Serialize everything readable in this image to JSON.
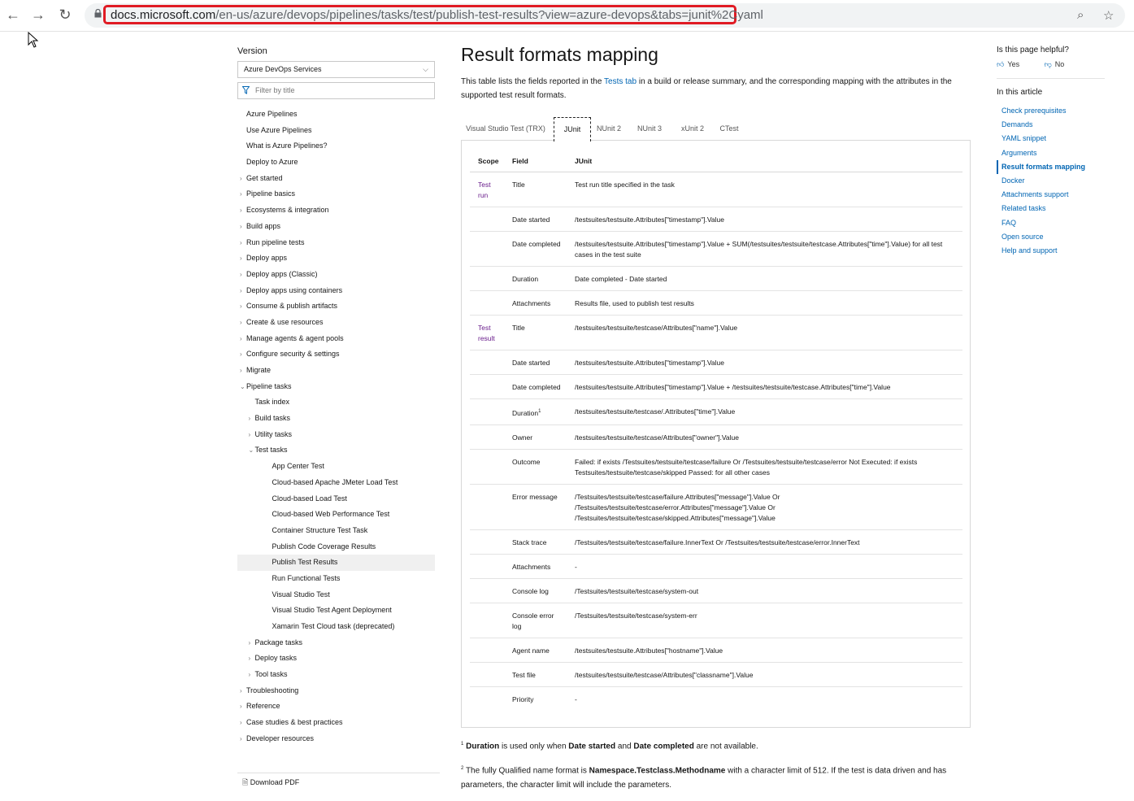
{
  "browser": {
    "url_domain": "docs.microsoft.com",
    "url_path": "/en-us/azure/devops/pipelines/tasks/test/publish-test-results?view=azure-devops&tabs=junit%2Cyaml"
  },
  "sidebar": {
    "version_label": "Version",
    "version_selected": "Azure DevOps Services",
    "filter_placeholder": "Filter by title",
    "items": [
      {
        "label": "Azure Pipelines",
        "level": 0,
        "twisty": ""
      },
      {
        "label": "Use Azure Pipelines",
        "level": 0,
        "twisty": ""
      },
      {
        "label": "What is Azure Pipelines?",
        "level": 0,
        "twisty": ""
      },
      {
        "label": "Deploy to Azure",
        "level": 0,
        "twisty": ""
      },
      {
        "label": "Get started",
        "level": 0,
        "twisty": "›"
      },
      {
        "label": "Pipeline basics",
        "level": 0,
        "twisty": "›"
      },
      {
        "label": "Ecosystems & integration",
        "level": 0,
        "twisty": "›"
      },
      {
        "label": "Build apps",
        "level": 0,
        "twisty": "›"
      },
      {
        "label": "Run pipeline tests",
        "level": 0,
        "twisty": "›"
      },
      {
        "label": "Deploy apps",
        "level": 0,
        "twisty": "›"
      },
      {
        "label": "Deploy apps (Classic)",
        "level": 0,
        "twisty": "›"
      },
      {
        "label": "Deploy apps using containers",
        "level": 0,
        "twisty": "›"
      },
      {
        "label": "Consume & publish artifacts",
        "level": 0,
        "twisty": "›"
      },
      {
        "label": "Create & use resources",
        "level": 0,
        "twisty": "›"
      },
      {
        "label": "Manage agents & agent pools",
        "level": 0,
        "twisty": "›"
      },
      {
        "label": "Configure security & settings",
        "level": 0,
        "twisty": "›"
      },
      {
        "label": "Migrate",
        "level": 0,
        "twisty": "›"
      },
      {
        "label": "Pipeline tasks",
        "level": 0,
        "twisty": "⌄"
      },
      {
        "label": "Task index",
        "level": 1,
        "twisty": ""
      },
      {
        "label": "Build tasks",
        "level": 1,
        "twisty": "›"
      },
      {
        "label": "Utility tasks",
        "level": 1,
        "twisty": "›"
      },
      {
        "label": "Test tasks",
        "level": 1,
        "twisty": "⌄"
      },
      {
        "label": "App Center Test",
        "level": 2,
        "twisty": ""
      },
      {
        "label": "Cloud-based Apache JMeter Load Test",
        "level": 2,
        "twisty": ""
      },
      {
        "label": "Cloud-based Load Test",
        "level": 2,
        "twisty": ""
      },
      {
        "label": "Cloud-based Web Performance Test",
        "level": 2,
        "twisty": ""
      },
      {
        "label": "Container Structure Test Task",
        "level": 2,
        "twisty": ""
      },
      {
        "label": "Publish Code Coverage Results",
        "level": 2,
        "twisty": ""
      },
      {
        "label": "Publish Test Results",
        "level": 2,
        "twisty": "",
        "selected": true
      },
      {
        "label": "Run Functional Tests",
        "level": 2,
        "twisty": ""
      },
      {
        "label": "Visual Studio Test",
        "level": 2,
        "twisty": ""
      },
      {
        "label": "Visual Studio Test Agent Deployment",
        "level": 2,
        "twisty": ""
      },
      {
        "label": "Xamarin Test Cloud task (deprecated)",
        "level": 2,
        "twisty": ""
      },
      {
        "label": "Package tasks",
        "level": 1,
        "twisty": "›"
      },
      {
        "label": "Deploy tasks",
        "level": 1,
        "twisty": "›"
      },
      {
        "label": "Tool tasks",
        "level": 1,
        "twisty": "›"
      },
      {
        "label": "Troubleshooting",
        "level": 0,
        "twisty": "›"
      },
      {
        "label": "Reference",
        "level": 0,
        "twisty": "›"
      },
      {
        "label": "Case studies & best practices",
        "level": 0,
        "twisty": "›"
      },
      {
        "label": "Developer resources",
        "level": 0,
        "twisty": "›"
      }
    ],
    "download_pdf": "Download PDF"
  },
  "main": {
    "title": "Result formats mapping",
    "intro_before": "This table lists the fields reported in the ",
    "intro_link": "Tests tab",
    "intro_after": " in a build or release summary, and the corresponding mapping with the attributes in the supported test result formats.",
    "tabs": [
      {
        "label": "Visual Studio Test (TRX)",
        "active": false
      },
      {
        "label": "JUnit",
        "active": true
      },
      {
        "label": "NUnit 2",
        "active": false
      },
      {
        "label": "NUnit 3",
        "active": false
      },
      {
        "label": "xUnit 2",
        "active": false
      },
      {
        "label": "CTest",
        "active": false
      }
    ],
    "table_headers": [
      "Scope",
      "Field",
      "JUnit"
    ],
    "rows": [
      {
        "scope": "Test run",
        "field": "Title",
        "value": "Test run title specified in the task"
      },
      {
        "scope": "",
        "field": "Date started",
        "value": "/testsuites/testsuite.Attributes[\"timestamp\"].Value"
      },
      {
        "scope": "",
        "field": "Date completed",
        "value": "/testsuites/testsuite.Attributes[\"timestamp\"].Value + SUM(/testsuites/testsuite/testcase.Attributes[\"time\"].Value) for all test cases in the test suite"
      },
      {
        "scope": "",
        "field": "Duration",
        "value": "Date completed - Date started"
      },
      {
        "scope": "",
        "field": "Attachments",
        "value": "Results file, used to publish test results"
      },
      {
        "scope": "Test result",
        "field": "Title",
        "value": "/testsuites/testsuite/testcase/Attributes[\"name\"].Value"
      },
      {
        "scope": "",
        "field": "Date started",
        "value": "/testsuites/testsuite.Attributes[\"timestamp\"].Value"
      },
      {
        "scope": "",
        "field": "Date completed",
        "value": "/testsuites/testsuite.Attributes[\"timestamp\"].Value + /testsuites/testsuite/testcase.Attributes[\"time\"].Value"
      },
      {
        "scope": "",
        "field": "Duration",
        "sup": "1",
        "value": "/testsuites/testsuite/testcase/.Attributes[\"time\"].Value"
      },
      {
        "scope": "",
        "field": "Owner",
        "value": "/testsuites/testsuite/testcase/Attributes[\"owner\"].Value"
      },
      {
        "scope": "",
        "field": "Outcome",
        "value": "Failed: if exists /Testsuites/testsuite/testcase/failure Or /Testsuites/testsuite/testcase/error Not Executed: if exists Testsuites/testsuite/testcase/skipped Passed: for all other cases"
      },
      {
        "scope": "",
        "field": "Error message",
        "value": "/Testsuites/testsuite/testcase/failure.Attributes[\"message\"].Value Or /Testsuites/testsuite/testcase/error.Attributes[\"message\"].Value Or /Testsuites/testsuite/testcase/skipped.Attributes[\"message\"].Value"
      },
      {
        "scope": "",
        "field": "Stack trace",
        "value": "/Testsuites/testsuite/testcase/failure.InnerText Or /Testsuites/testsuite/testcase/error.InnerText"
      },
      {
        "scope": "",
        "field": "Attachments",
        "value": "-"
      },
      {
        "scope": "",
        "field": "Console log",
        "value": "/Testsuites/testsuite/testcase/system-out"
      },
      {
        "scope": "",
        "field": "Console error log",
        "value": "/Testsuites/testsuite/testcase/system-err"
      },
      {
        "scope": "",
        "field": "Agent name",
        "value": "/testsuites/testsuite.Attributes[\"hostname\"].Value"
      },
      {
        "scope": "",
        "field": "Test file",
        "value": "/testsuites/testsuite/testcase/Attributes[\"classname\"].Value"
      },
      {
        "scope": "",
        "field": "Priority",
        "value": "-"
      }
    ],
    "note1_sup": "1",
    "note1_b1": "Duration",
    "note1_t1": " is used only when ",
    "note1_b2": "Date started",
    "note1_t2": " and ",
    "note1_b3": "Date completed",
    "note1_t3": " are not available.",
    "note2_sup": "2",
    "note2_t1": " The fully Qualified name format is ",
    "note2_b1": "Namespace.Testclass.Methodname",
    "note2_t2": " with a character limit of 512. If the test is data driven and has parameters, the character limit will include the parameters."
  },
  "right": {
    "helpful": "Is this page helpful?",
    "yes": "Yes",
    "no": "No",
    "in_this_article": "In this article",
    "links": [
      {
        "label": "Check prerequisites",
        "current": false
      },
      {
        "label": "Demands",
        "current": false
      },
      {
        "label": "YAML snippet",
        "current": false
      },
      {
        "label": "Arguments",
        "current": false
      },
      {
        "label": "Result formats mapping",
        "current": true
      },
      {
        "label": "Docker",
        "current": false
      },
      {
        "label": "Attachments support",
        "current": false
      },
      {
        "label": "Related tasks",
        "current": false
      },
      {
        "label": "FAQ",
        "current": false
      },
      {
        "label": "Open source",
        "current": false
      },
      {
        "label": "Help and support",
        "current": false
      }
    ]
  }
}
